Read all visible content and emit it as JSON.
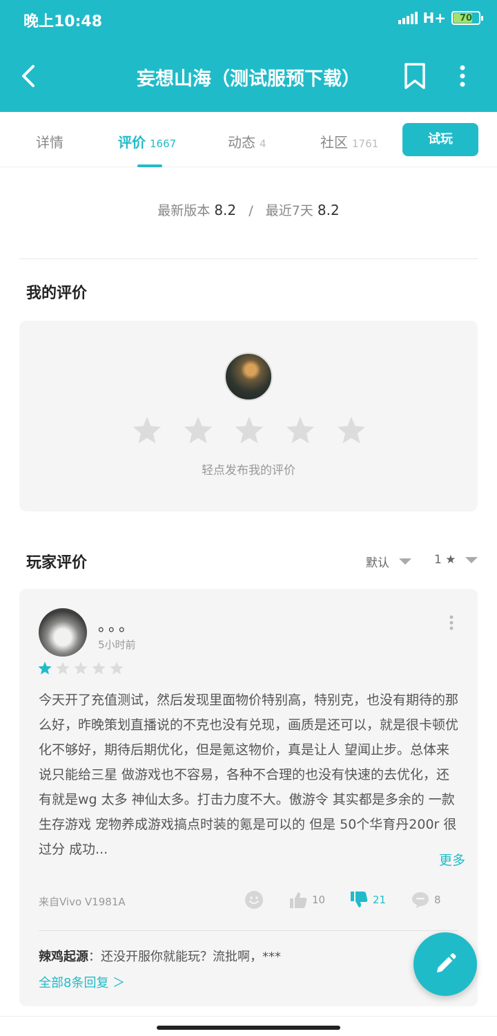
{
  "status": {
    "time": "晚上10:48",
    "network": "H+",
    "battery": "70",
    "battery_level": 0.7
  },
  "nav": {
    "title": "妄想山海（测试服预下载）"
  },
  "tabs": [
    {
      "label": "详情",
      "count": ""
    },
    {
      "label": "评价",
      "count": "1667"
    },
    {
      "label": "动态",
      "count": "4"
    },
    {
      "label": "社区",
      "count": "1761"
    }
  ],
  "try_label": "试玩",
  "ratings": {
    "latest_label": "最新版本",
    "latest": "8.2",
    "sep": "/",
    "recent_label": "最近7天",
    "recent": "8.2"
  },
  "my_review": {
    "title": "我的评价",
    "prompt": "轻点发布我的评价",
    "stars": 5
  },
  "player_reviews": {
    "title": "玩家评价",
    "sort": "默认",
    "filter": "1 ★"
  },
  "review": {
    "user": "。。。",
    "time": "5小时前",
    "rating": 1,
    "text": "今天开了充值测试，然后发现里面物价特别高，特别克，也没有期待的那么好，昨晚策划直播说的不克也没有兑现，画质是还可以，就是很卡顿优化不够好，期待后期优化，但是氪这物价，真是让人 望闻止步。总体来说只能给三星 做游戏也不容易，各种不合理的也没有快速的去优化，还有就是wg 太多 神仙太多。打击力度不大。傲游令 其实都是多余的 一款生存游戏 宠物养成游戏搞点时装的氪是可以的 但是 50个华育丹200r 很过分 成功...",
    "more": "更多",
    "device": "来自Vivo V1981A",
    "likes": "10",
    "dislikes": "21",
    "comments": "8",
    "reply_user": "辣鸡起源",
    "reply_text": "：还没开服你就能玩？流批啊，***",
    "all_replies": "全部8条回复 ＞"
  },
  "colors": {
    "accent": "#20bbc9",
    "card_bg": "#f5f5f5"
  }
}
